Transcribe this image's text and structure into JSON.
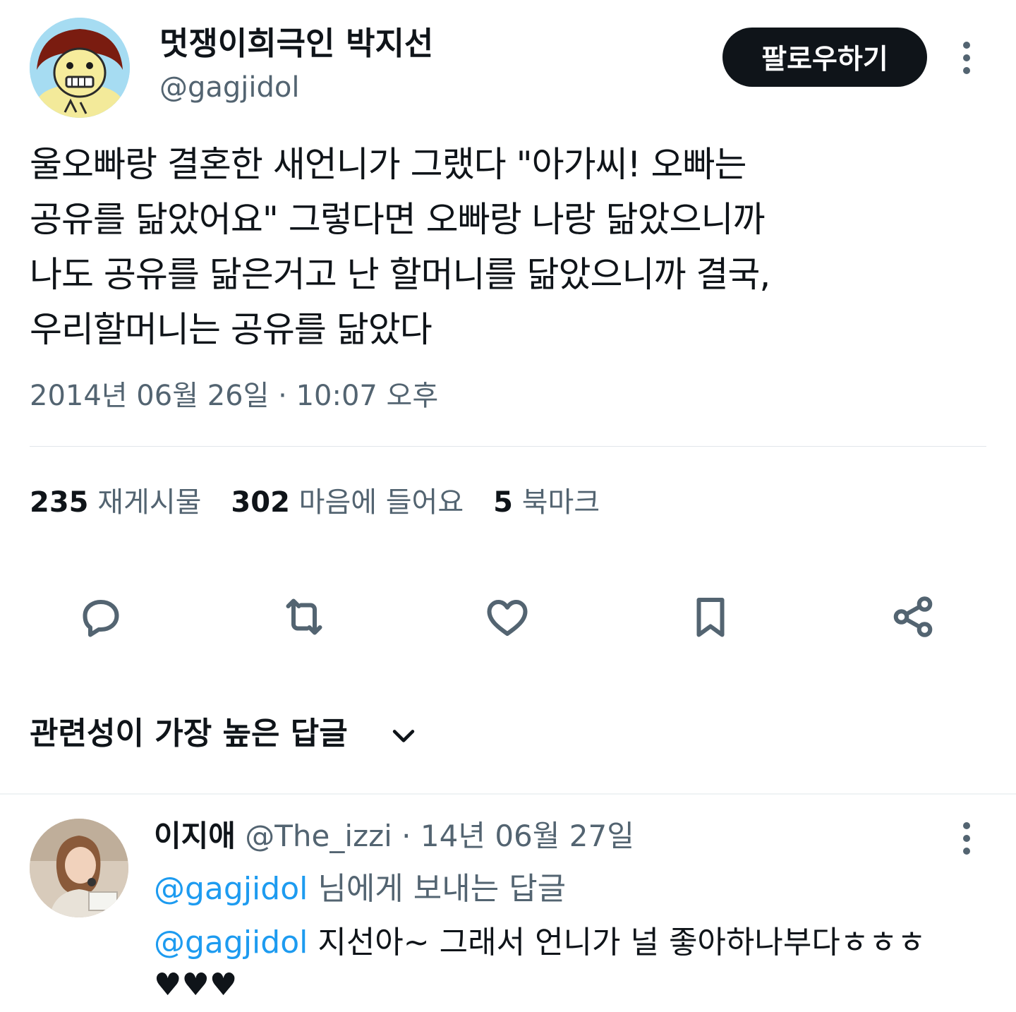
{
  "author": {
    "display_name": "멋쟁이희극인 박지선",
    "handle": "@gagjidol",
    "follow_label": "팔로우하기"
  },
  "tweet": {
    "text": "울오빠랑 결혼한 새언니가 그랬다 \"아가씨! 오빠는\n공유를 닮았어요\" 그렇다면 오빠랑 나랑 닮았으니까\n나도 공유를 닮은거고 난 할머니를 닮았으니까 결국,\n우리할머니는 공유를 닮았다",
    "timestamp": "2014년 06월 26일 · 10:07 오후"
  },
  "stats": {
    "retweets": {
      "count": "235",
      "label": "재게시물"
    },
    "likes": {
      "count": "302",
      "label": "마음에 들어요"
    },
    "bookmarks": {
      "count": "5",
      "label": "북마크"
    }
  },
  "actions": [
    "reply-icon",
    "retweet-icon",
    "like-icon",
    "bookmark-icon",
    "share-icon"
  ],
  "replies_sort": {
    "label": "관련성이 가장 높은 답글"
  },
  "reply": {
    "display_name": "이지애",
    "handle": "@The_izzi",
    "date": " · 14년 06월 27일",
    "replying_to_mention": "@gagjidol",
    "replying_to_suffix": " 님에게 보내는 답글",
    "mention": "@gagjidol",
    "text": " 지선아~ 그래서 언니가 널 좋아하나부다ㅎㅎㅎ ♥♥♥"
  },
  "colors": {
    "text_primary": "#0f1419",
    "text_secondary": "#536471",
    "link": "#1d9bf0",
    "divider": "#eff3f4"
  }
}
